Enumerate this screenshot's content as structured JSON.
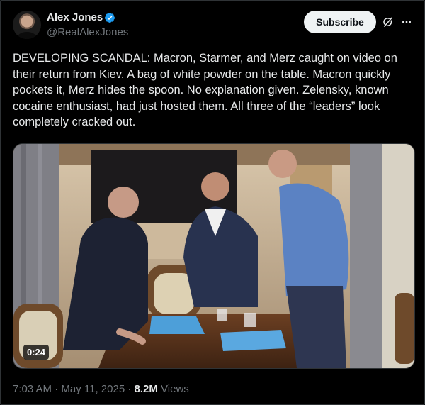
{
  "author": {
    "name": "Alex Jones",
    "handle": "@RealAlexJones",
    "verified": true
  },
  "actions": {
    "subscribe_label": "Subscribe",
    "grok_icon": "grok-icon",
    "more_icon": "more-icon"
  },
  "tweet": {
    "text": "DEVELOPING SCANDAL: Macron, Starmer, and Merz caught on video on their return from Kiev. A bag of white powder on the table. Macron quickly pockets it, Merz hides the spoon. No explanation given. Zelensky, known cocaine enthusiast, had just hosted them. All three of the “leaders” look completely cracked out."
  },
  "video": {
    "duration": "0:24"
  },
  "meta": {
    "time": "7:03 AM",
    "separator": "·",
    "date": "May 11, 2025",
    "views_count": "8.2M",
    "views_label": "Views"
  },
  "colors": {
    "background": "#000000",
    "text": "#e7e9ea",
    "secondary": "#71767b",
    "verified": "#1d9bf0",
    "button_bg": "#eff3f4"
  }
}
